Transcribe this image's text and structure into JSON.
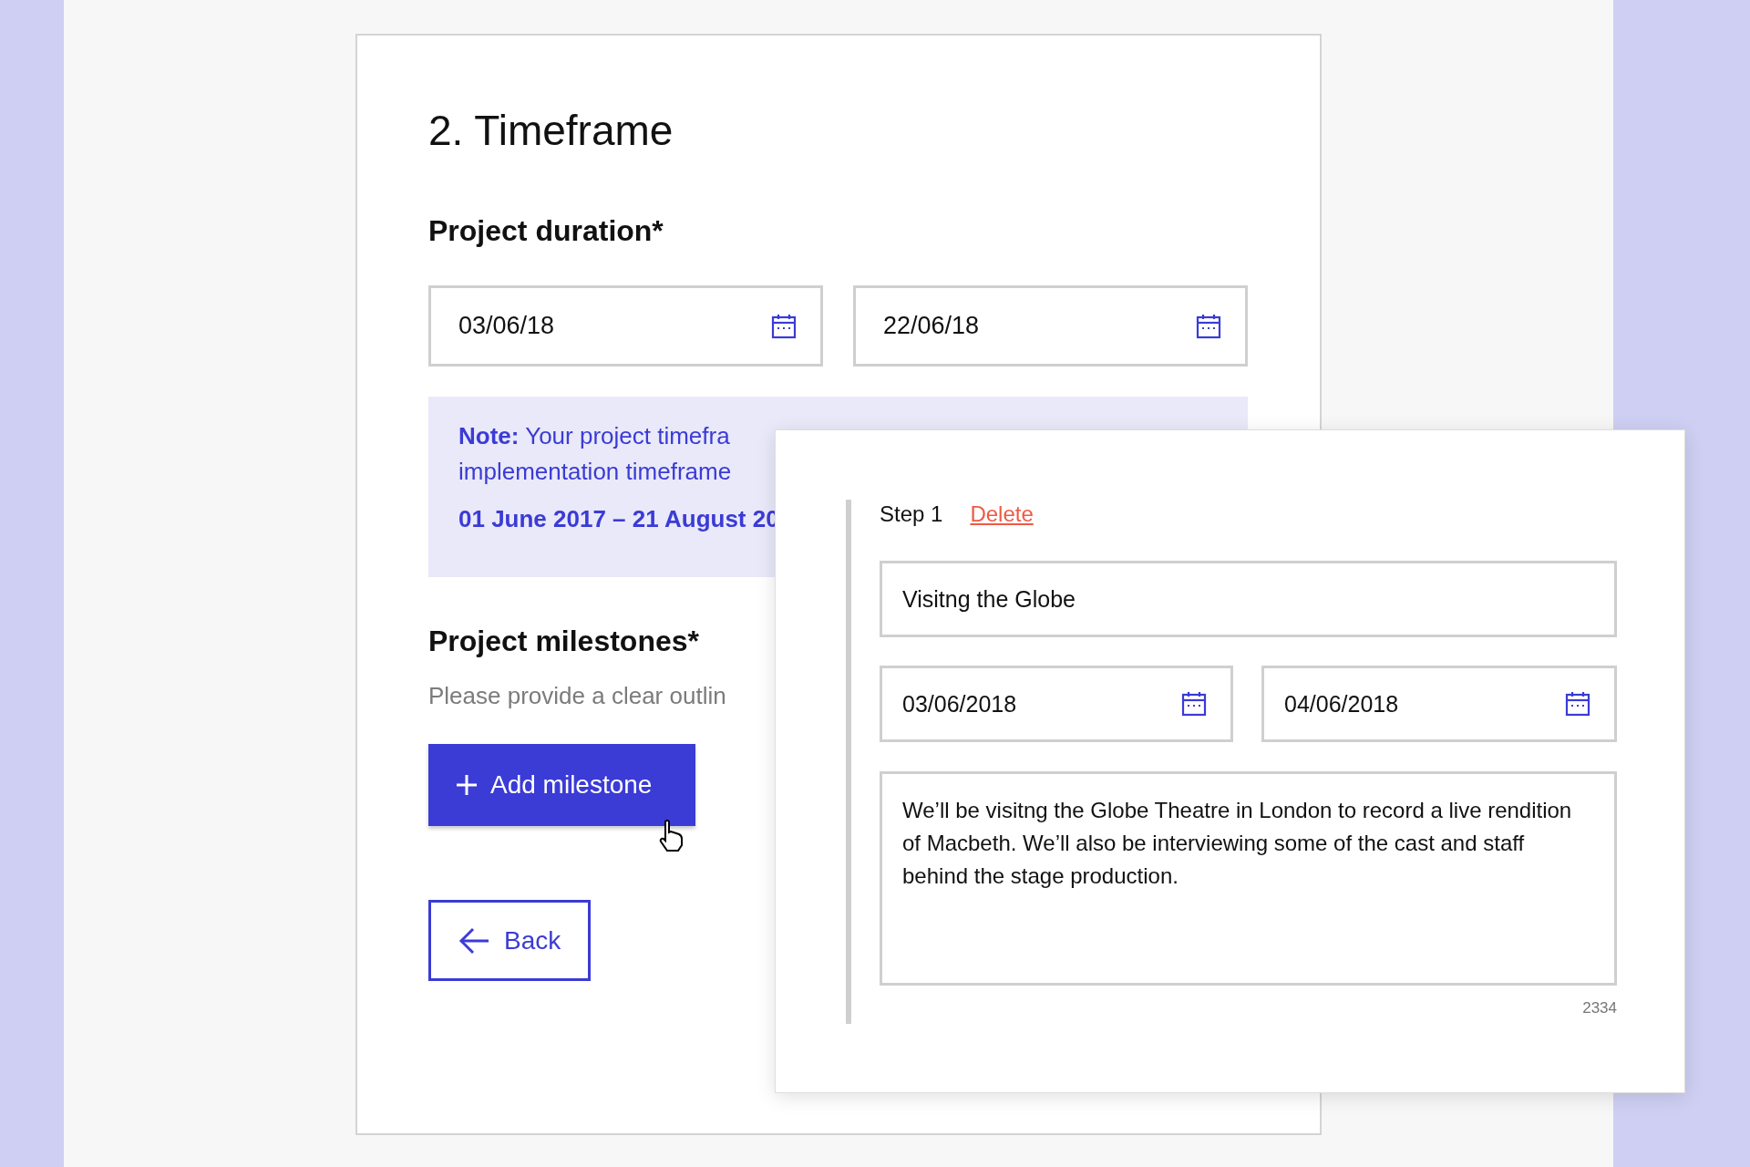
{
  "heading": "2. Timeframe",
  "duration": {
    "label": "Project duration*",
    "start": "03/06/18",
    "end": "22/06/18"
  },
  "note": {
    "lines": [
      "**Note:** Your project timefra",
      "implementation timeframe"
    ],
    "range": "01 June 2017 – 21 August 20"
  },
  "milestones": {
    "label": "Project milestones*",
    "hint": "Please provide a clear outlin",
    "add_button": "Add milestone"
  },
  "back_button": "Back",
  "milestone_panel": {
    "step": "Step 1",
    "delete": "Delete",
    "title": "Visitng the Globe",
    "start": "03/06/2018",
    "end": "04/06/2018",
    "description": "We’ll be visitng the Globe Theatre in London to record a live rendition of Macbeth. We’ll also be interviewing some of the cast and staff behind the stage production.",
    "count": "2334"
  }
}
